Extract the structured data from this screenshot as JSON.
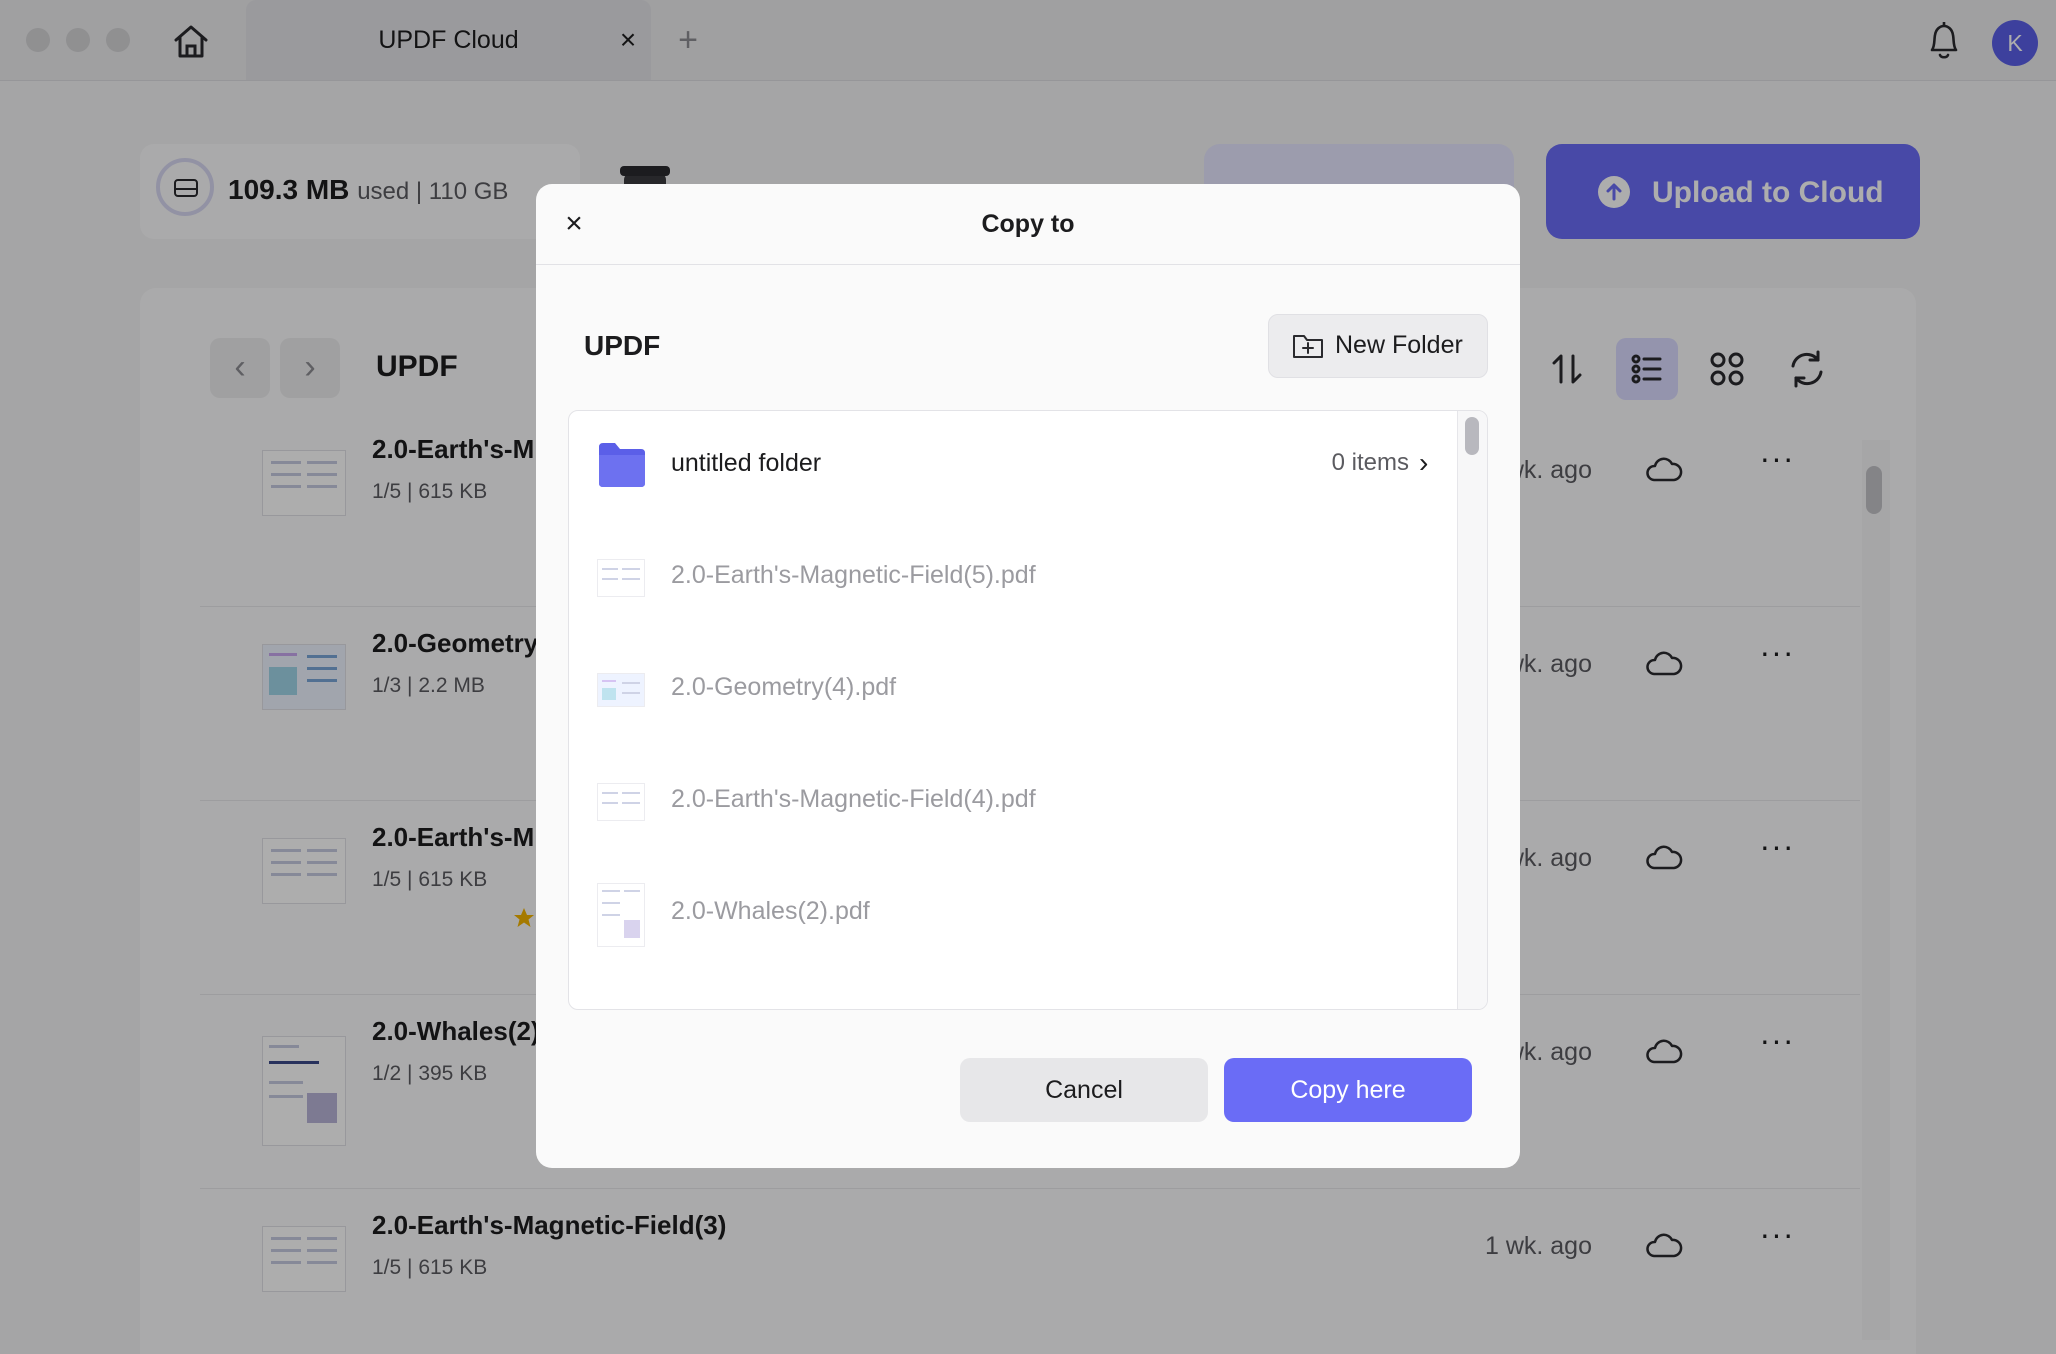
{
  "window": {
    "tab_title": "UPDF Cloud",
    "tab_close": "×",
    "tab_add": "+",
    "avatar_letter": "K"
  },
  "storage": {
    "used": "109.3 MB",
    "rest": "used | 110 GB"
  },
  "actions": {
    "upload_label": "Upload to Cloud"
  },
  "browser": {
    "breadcrumb": "UPDF",
    "prev": "‹",
    "next": "›",
    "rows": [
      {
        "title": "2.0-Earth's-M",
        "meta": "1/5 | 615 KB",
        "time": "wk. ago",
        "more": "···"
      },
      {
        "title": "2.0-Geometry",
        "meta": "1/3 | 2.2 MB",
        "time": "wk. ago",
        "more": "···"
      },
      {
        "title": "2.0-Earth's-M",
        "meta": "1/5 | 615 KB",
        "time": "wk. ago",
        "more": "···"
      },
      {
        "title": "2.0-Whales(2)",
        "meta": "1/2 | 395 KB",
        "time": "wk. ago",
        "more": "···"
      },
      {
        "title": "2.0-Earth's-Magnetic-Field(3)",
        "meta": "1/5 | 615 KB",
        "time": "1 wk. ago",
        "more": "···"
      }
    ]
  },
  "dialog": {
    "close": "×",
    "title": "Copy to",
    "breadcrumb": "UPDF",
    "new_folder_label": "New Folder",
    "items": [
      {
        "name": "untitled folder",
        "count": "0 items",
        "chevron": "›"
      },
      {
        "name": "2.0-Earth's-Magnetic-Field(5).pdf"
      },
      {
        "name": "2.0-Geometry(4).pdf"
      },
      {
        "name": "2.0-Earth's-Magnetic-Field(4).pdf"
      },
      {
        "name": "2.0-Whales(2).pdf"
      }
    ],
    "cancel_label": "Cancel",
    "confirm_label": "Copy here"
  },
  "colors": {
    "accent": "#6a6cf6",
    "folder": "#5b5fe8",
    "star": "#f4b400"
  }
}
